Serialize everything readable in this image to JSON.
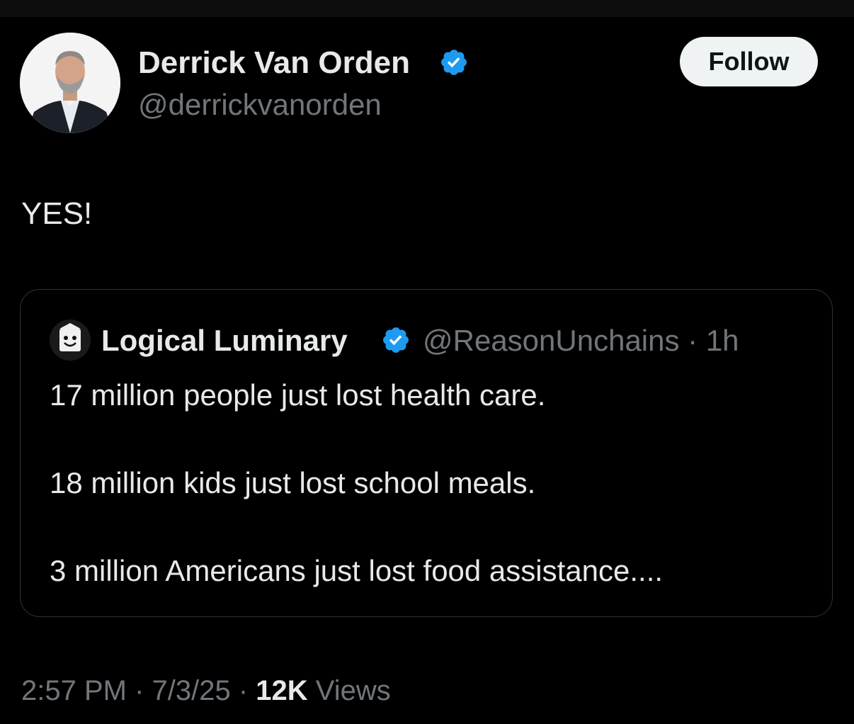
{
  "author": {
    "name": "Derrick Van Orden",
    "handle": "@derrickvanorden",
    "follow_label": "Follow"
  },
  "tweet": {
    "text": "YES!"
  },
  "quoted": {
    "name": "Logical Luminary",
    "handle": "@ReasonUnchains",
    "separator": " · ",
    "age": "1h",
    "lines": [
      "17 million people just lost health care.",
      "18 million kids just lost school meals.",
      "3 million Americans just lost food assistance...."
    ]
  },
  "footer": {
    "time": "2:57 PM",
    "sep1": " · ",
    "date": "7/3/25",
    "sep2": " · ",
    "views_count": "12K",
    "views_label": " Views"
  },
  "colors": {
    "background": "#000000",
    "text": "#e7e9ea",
    "muted": "#71767b",
    "verified": "#1d9bf0",
    "border": "#2f3336",
    "follow_bg": "#eff3f4"
  },
  "icons": {
    "verified": "verified-badge-icon"
  }
}
